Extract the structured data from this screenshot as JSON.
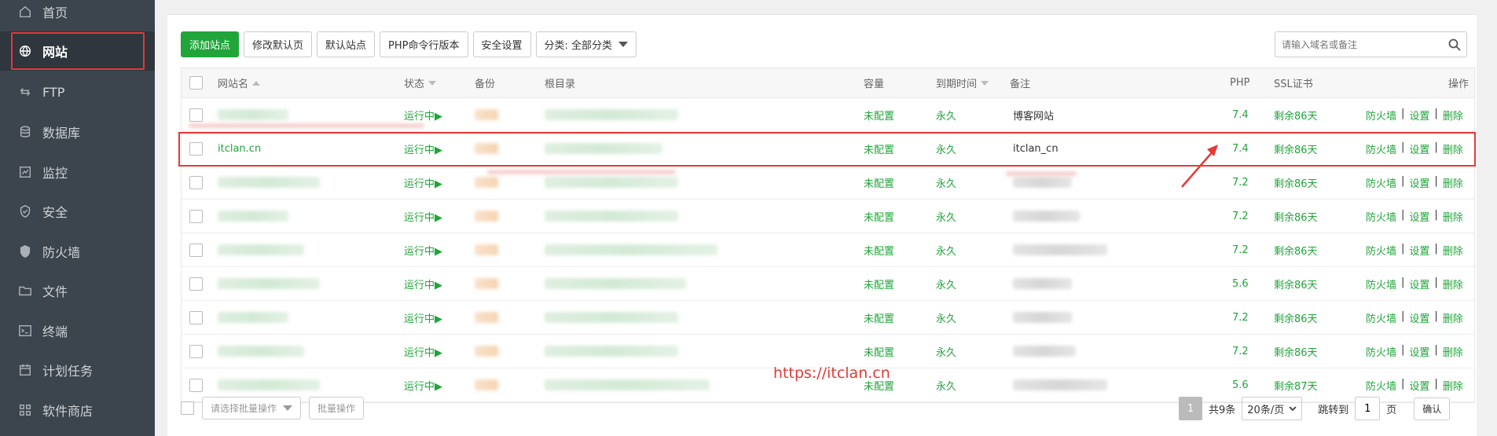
{
  "sidebar": {
    "items": [
      {
        "label": "首页",
        "icon": "home-icon"
      },
      {
        "label": "网站",
        "icon": "globe-icon",
        "active": true
      },
      {
        "label": "FTP",
        "icon": "ftp-icon"
      },
      {
        "label": "数据库",
        "icon": "database-icon"
      },
      {
        "label": "监控",
        "icon": "monitor-icon"
      },
      {
        "label": "安全",
        "icon": "shield-check-icon"
      },
      {
        "label": "防火墙",
        "icon": "firewall-shield-icon"
      },
      {
        "label": "文件",
        "icon": "folder-icon"
      },
      {
        "label": "终端",
        "icon": "terminal-icon"
      },
      {
        "label": "计划任务",
        "icon": "calendar-icon"
      },
      {
        "label": "软件商店",
        "icon": "apps-grid-icon"
      }
    ]
  },
  "toolbar": {
    "add_site": "添加站点",
    "edit_default_page": "修改默认页",
    "default_site": "默认站点",
    "php_cli_version": "PHP命令行版本",
    "security_settings": "安全设置",
    "category_select": "分类: 全部分类"
  },
  "search": {
    "placeholder": "请输入域名或备注"
  },
  "table": {
    "headers": {
      "name": "网站名",
      "status": "状态",
      "backup": "备份",
      "root": "根目录",
      "quota": "容量",
      "expire": "到期时间",
      "remark": "备注",
      "php": "PHP",
      "ssl": "SSL证书",
      "ops": "操作"
    },
    "rows": [
      {
        "name": "",
        "status": "运行中▶",
        "quota": "未配置",
        "expire": "永久",
        "remark": "博客网站",
        "php": "7.4",
        "ssl": "剩余86天"
      },
      {
        "name": "itclan.cn",
        "status": "运行中▶",
        "quota": "未配置",
        "expire": "永久",
        "remark": "itclan_cn",
        "php": "7.4",
        "ssl": "剩余86天"
      },
      {
        "name": "",
        "status": "运行中▶",
        "quota": "未配置",
        "expire": "永久",
        "remark": "",
        "php": "7.2",
        "ssl": "剩余86天"
      },
      {
        "name": "",
        "status": "运行中▶",
        "quota": "未配置",
        "expire": "永久",
        "remark": "",
        "php": "7.2",
        "ssl": "剩余86天"
      },
      {
        "name": "",
        "status": "运行中▶",
        "quota": "未配置",
        "expire": "永久",
        "remark": "",
        "php": "7.2",
        "ssl": "剩余86天"
      },
      {
        "name": "",
        "status": "运行中▶",
        "quota": "未配置",
        "expire": "永久",
        "remark": "",
        "php": "5.6",
        "ssl": "剩余86天"
      },
      {
        "name": "",
        "status": "运行中▶",
        "quota": "未配置",
        "expire": "永久",
        "remark": "",
        "php": "7.2",
        "ssl": "剩余86天"
      },
      {
        "name": "",
        "status": "运行中▶",
        "quota": "未配置",
        "expire": "永久",
        "remark": "",
        "php": "7.2",
        "ssl": "剩余86天"
      },
      {
        "name": "",
        "status": "运行中▶",
        "quota": "未配置",
        "expire": "永久",
        "remark": "",
        "php": "5.6",
        "ssl": "剩余87天"
      }
    ],
    "ops": {
      "firewall": "防火墙",
      "settings": "设置",
      "delete": "删除",
      "sep": "|"
    }
  },
  "batch": {
    "select_placeholder": "请选择批量操作",
    "button": "批量操作"
  },
  "pagination": {
    "current": "1",
    "total": "共9条",
    "per_page": "20条/页",
    "jump_label": "跳转到",
    "jump_value": "1",
    "page_unit": "页",
    "confirm": "确认"
  },
  "watermark": "https://itclan.cn",
  "colors": {
    "accent": "#20a53a",
    "annotation": "#e53935",
    "sidebar_bg": "#3c444d"
  }
}
